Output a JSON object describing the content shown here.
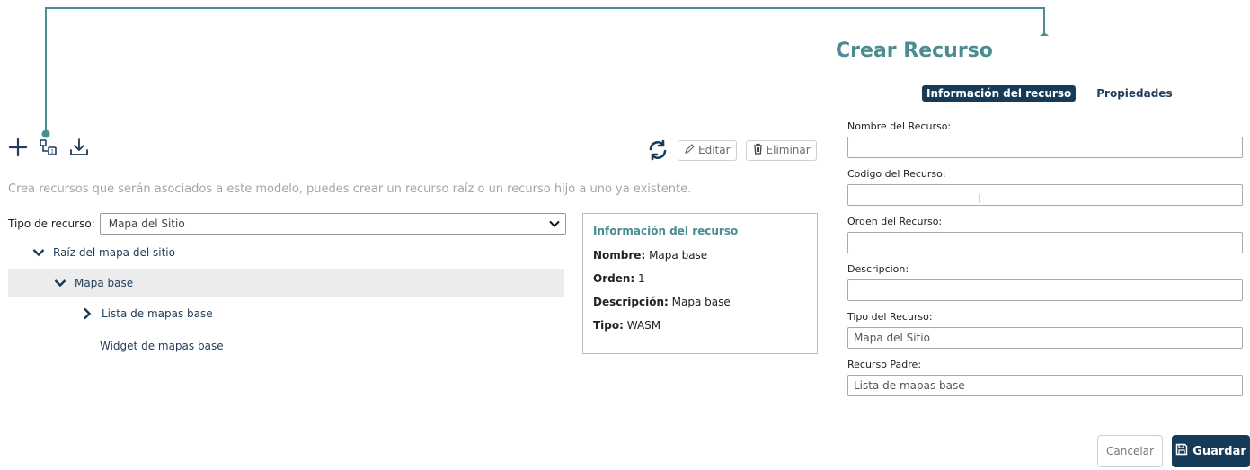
{
  "header": {
    "title": "Crear Recurso"
  },
  "tabs": [
    {
      "label": "Información del recurso",
      "active": true
    },
    {
      "label": "Propiedades",
      "active": false
    }
  ],
  "toolbar": {
    "icons": [
      "plus-icon",
      "shapes-icon",
      "download-icon"
    ],
    "refresh_icon": "refresh-icon",
    "edit_label": "Editar",
    "delete_label": "Eliminar"
  },
  "intro_text": "Crea recursos que serán asociados a este modelo, puedes crear un recurso raíz o un recurso hijo a uno ya existente.",
  "resource_type": {
    "label": "Tipo de recurso:",
    "value": "Mapa del Sitio"
  },
  "tree": [
    {
      "label": "Raíz del mapa del sitio",
      "expanded": true,
      "level": 1
    },
    {
      "label": "Mapa base",
      "expanded": true,
      "level": 2,
      "selected": true
    },
    {
      "label": "Lista de mapas base",
      "expanded": false,
      "level": 3
    },
    {
      "label": "Widget de mapas base",
      "level": 3
    }
  ],
  "info_panel": {
    "title": "Información del recurso",
    "nombre_label": "Nombre:",
    "nombre": "Mapa base",
    "orden_label": "Orden:",
    "orden": "1",
    "descripcion_label": "Descripción:",
    "descripcion": "Mapa base",
    "tipo_label": "Tipo:",
    "tipo": "WASM"
  },
  "form": {
    "fields": [
      {
        "label": "Nombre del Recurso:",
        "value": ""
      },
      {
        "label": "Codigo del Recurso:",
        "value": ""
      },
      {
        "label": "Orden del Recurso:",
        "value": ""
      },
      {
        "label": "Descripcion:",
        "value": ""
      },
      {
        "label": "Tipo del Recurso:",
        "value": "Mapa del Sitio"
      },
      {
        "label": "Recurso Padre:",
        "value": "Lista de mapas base"
      }
    ],
    "cancel_label": "Cancelar",
    "save_label": "Guardar"
  },
  "colors": {
    "accent": "#4a8d90",
    "primary": "#163b59",
    "selected_row": "#ececec"
  }
}
